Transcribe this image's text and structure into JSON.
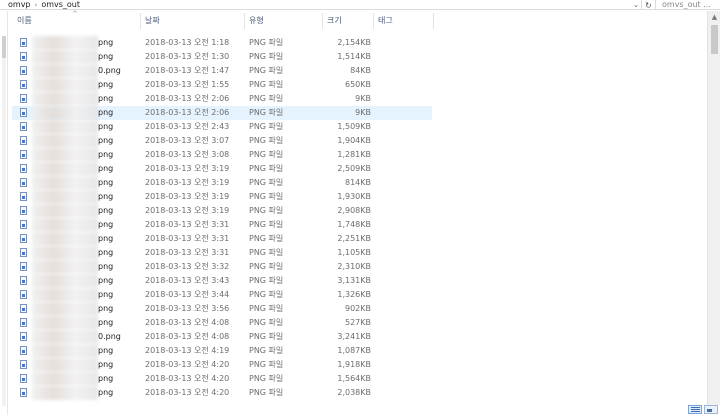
{
  "address": {
    "crumbs": [
      "omvp",
      "omvs_out"
    ],
    "separator": "›",
    "dropdown_glyph": "⌄",
    "refresh_glyph": "↻",
    "search_placeholder": "omvs_out ..."
  },
  "columns": {
    "name": "이름",
    "date": "날짜",
    "type": "유형",
    "size": "크기",
    "tags": "태그",
    "sort_glyph": "^"
  },
  "files": [
    {
      "name": "png",
      "date": "2018-03-13 오전 1:18",
      "type": "PNG 파일",
      "size": "2,154KB"
    },
    {
      "name": "png",
      "date": "2018-03-13 오전 1:30",
      "type": "PNG 파일",
      "size": "1,514KB"
    },
    {
      "name": "0.png",
      "date": "2018-03-13 오전 1:47",
      "type": "PNG 파일",
      "size": "84KB"
    },
    {
      "name": "png",
      "date": "2018-03-13 오전 1:55",
      "type": "PNG 파일",
      "size": "650KB"
    },
    {
      "name": "png",
      "date": "2018-03-13 오전 2:06",
      "type": "PNG 파일",
      "size": "9KB"
    },
    {
      "name": "png",
      "date": "2018-03-13 오전 2:06",
      "type": "PNG 파일",
      "size": "9KB"
    },
    {
      "name": "png",
      "date": "2018-03-13 오전 2:43",
      "type": "PNG 파일",
      "size": "1,509KB"
    },
    {
      "name": "png",
      "date": "2018-03-13 오전 3:07",
      "type": "PNG 파일",
      "size": "1,904KB"
    },
    {
      "name": "png",
      "date": "2018-03-13 오전 3:08",
      "type": "PNG 파일",
      "size": "1,281KB"
    },
    {
      "name": "png",
      "date": "2018-03-13 오전 3:19",
      "type": "PNG 파일",
      "size": "2,509KB"
    },
    {
      "name": "png",
      "date": "2018-03-13 오전 3:19",
      "type": "PNG 파일",
      "size": "814KB"
    },
    {
      "name": "png",
      "date": "2018-03-13 오전 3:19",
      "type": "PNG 파일",
      "size": "1,930KB"
    },
    {
      "name": "png",
      "date": "2018-03-13 오전 3:19",
      "type": "PNG 파일",
      "size": "2,908KB"
    },
    {
      "name": "png",
      "date": "2018-03-13 오전 3:31",
      "type": "PNG 파일",
      "size": "1,748KB"
    },
    {
      "name": "png",
      "date": "2018-03-13 오전 3:31",
      "type": "PNG 파일",
      "size": "2,251KB"
    },
    {
      "name": "png",
      "date": "2018-03-13 오전 3:31",
      "type": "PNG 파일",
      "size": "1,105KB"
    },
    {
      "name": "png",
      "date": "2018-03-13 오전 3:32",
      "type": "PNG 파일",
      "size": "2,310KB"
    },
    {
      "name": "png",
      "date": "2018-03-13 오전 3:43",
      "type": "PNG 파일",
      "size": "3,131KB"
    },
    {
      "name": "png",
      "date": "2018-03-13 오전 3:44",
      "type": "PNG 파일",
      "size": "1,326KB"
    },
    {
      "name": "png",
      "date": "2018-03-13 오전 3:56",
      "type": "PNG 파일",
      "size": "902KB"
    },
    {
      "name": "png",
      "date": "2018-03-13 오전 4:08",
      "type": "PNG 파일",
      "size": "527KB"
    },
    {
      "name": "0.png",
      "date": "2018-03-13 오전 4:08",
      "type": "PNG 파일",
      "size": "3,241KB"
    },
    {
      "name": "png",
      "date": "2018-03-13 오전 4:19",
      "type": "PNG 파일",
      "size": "1,087KB"
    },
    {
      "name": "png",
      "date": "2018-03-13 오전 4:20",
      "type": "PNG 파일",
      "size": "1,918KB"
    },
    {
      "name": "png",
      "date": "2018-03-13 오전 4:20",
      "type": "PNG 파일",
      "size": "1,564KB"
    },
    {
      "name": "png",
      "date": "2018-03-13 오전 4:20",
      "type": "PNG 파일",
      "size": "2,038KB"
    }
  ],
  "selected_index": 5,
  "scrollbar": {
    "up_glyph": "▲"
  },
  "colors": {
    "selection": "#e5f3ff",
    "header_text": "#4b5a78",
    "accent": "#0078d7"
  }
}
